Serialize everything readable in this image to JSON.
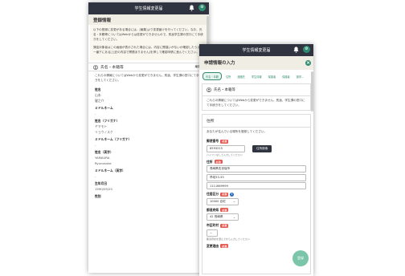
{
  "app": {
    "title": "学生情報変更届"
  },
  "screen1": {
    "page_title": "登録情報",
    "notice_p1": "以下の登録に変更がある場合には、[編集]より変更届けを行ってください。なお、氏名・本籍等についてはWebからは変更ができませんので、別途学生課の窓口にて手続きをしてください。",
    "notice_p2": "課金対象者はこの画面が表示された場合には、内容に間違いがないか確認したうえ、一番下にある[上記の内容で問題ありません]を押して確認申請に進んでください。",
    "section_title": "氏名・本籍等",
    "edit_label": "編集 >",
    "intro": "これらの情報についてはWebから変更ができません。別途、学生課の窓口にて手続きをしてください。",
    "fields": [
      {
        "label": "姓名",
        "values": [
          "山本",
          "健之介"
        ]
      },
      {
        "label": "ミドルネーム",
        "values": [
          "-"
        ]
      },
      {
        "label": "姓名（フリガナ）",
        "values": [
          "ヤマモト",
          "リョウノスケ"
        ]
      },
      {
        "label": "ミドルネーム（フリガナ）",
        "values": [
          "-"
        ]
      },
      {
        "label": "姓名（英字）",
        "values": [
          "YAMAURA",
          "Ryunosuke"
        ]
      },
      {
        "label": "ミドルネーム（英字）",
        "values": [
          "-"
        ]
      },
      {
        "label": "生年月日",
        "values": [
          "1990/05/20"
        ]
      },
      {
        "label": "性別",
        "values": []
      }
    ]
  },
  "screen2": {
    "page_title": "申請情報の入力",
    "tabs": [
      "氏名・本籍",
      "住所",
      "連絡先",
      "学生情報",
      "保護者",
      "保護者",
      "奨学…"
    ],
    "active_tab": 0,
    "name_card_title": "氏名・本籍等",
    "name_card_body": "これらの情報についてはWebから変更ができません。別途、学生課の窓口にて手続きをしてください。",
    "address": {
      "title": "住所",
      "desc": "あなたが住んでいる場所を登録してください。",
      "postal_label": "郵便番号",
      "postal_value": "8593215",
      "search_button": "住所検索",
      "postal_hint": "ハイフンなしで入力してください",
      "address_label": "住所",
      "address_lines": [
        "長崎県佐世保市",
        "早岐33-33",
        "1111669999"
      ],
      "housing_label": "住居区分",
      "housing_value": "10000 自宅",
      "prefecture_label": "都道府県",
      "prefecture_value": "42 長崎県",
      "city_label": "市区町村",
      "city_hint": "都道府県を選んでから入力してください",
      "change_reason_label": "変更理由"
    },
    "required_badge": "必須",
    "fab_label": "登録"
  }
}
